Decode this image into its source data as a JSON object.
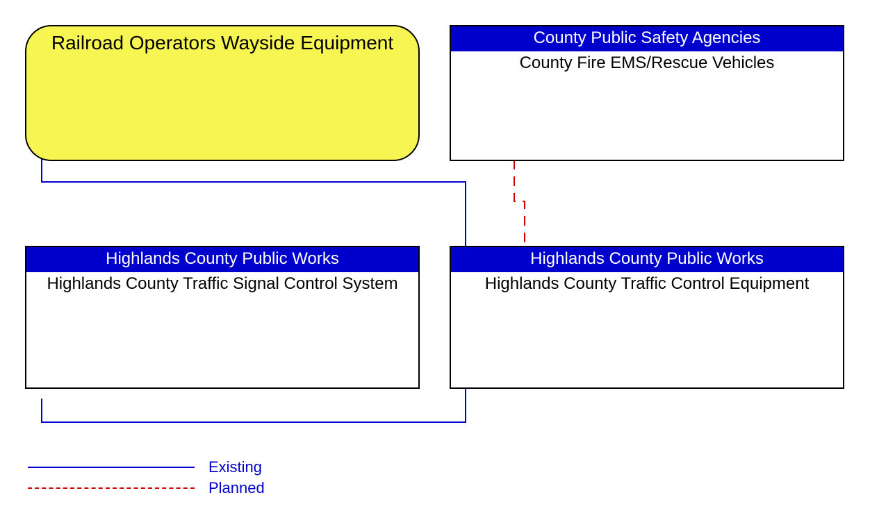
{
  "nodes": {
    "railroad": {
      "title": "Railroad Operators Wayside Equipment"
    },
    "countySafety": {
      "header": "County Public Safety Agencies",
      "body": "County Fire EMS/Rescue Vehicles"
    },
    "hcpwSignal": {
      "header": "Highlands County Public Works",
      "body": "Highlands County Traffic Signal Control System"
    },
    "hcpwEquip": {
      "header": "Highlands County Public Works",
      "body": "Highlands County Traffic Control Equipment"
    }
  },
  "legend": {
    "existing": "Existing",
    "planned": "Planned"
  }
}
